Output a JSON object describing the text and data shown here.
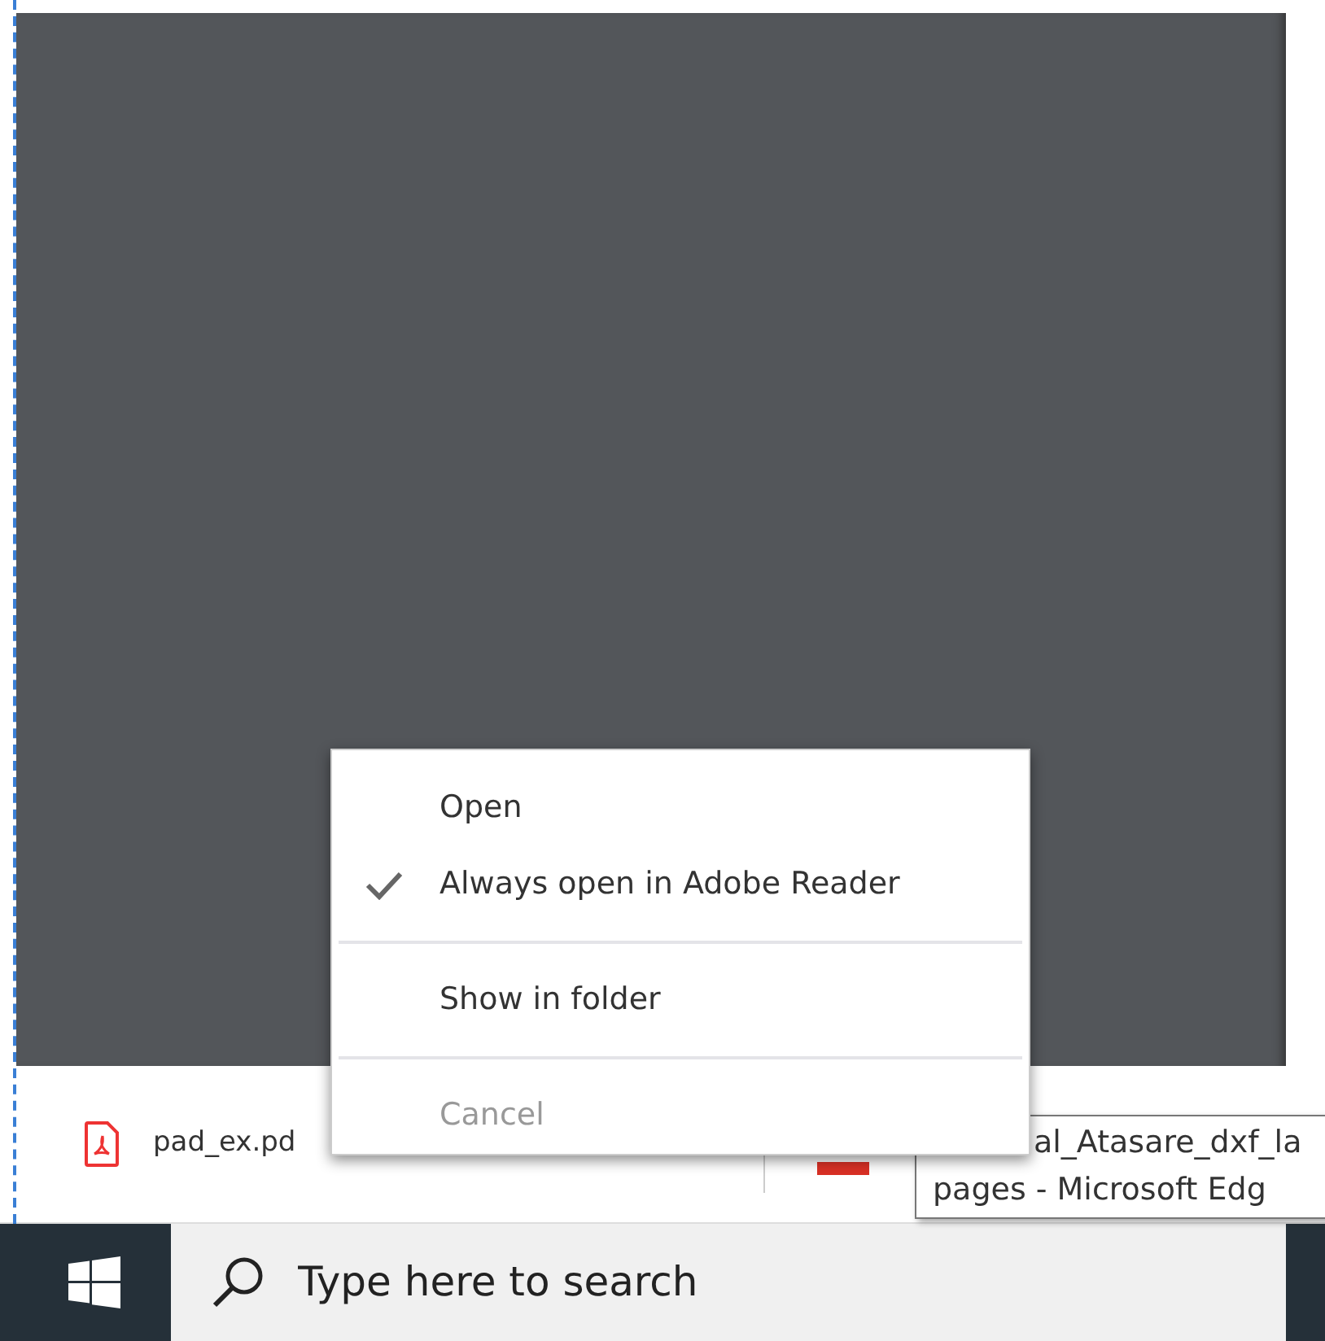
{
  "download_bar": {
    "items": [
      {
        "kind": "pdf",
        "file_name": "pad_ex.pd"
      },
      {
        "kind": "hidden"
      }
    ]
  },
  "context_menu": {
    "items": [
      {
        "kind": "item",
        "label": "Open",
        "checked": false,
        "disabled": false
      },
      {
        "kind": "item",
        "label": "Always open in Adobe Reader",
        "checked": true,
        "disabled": false
      },
      {
        "kind": "divider"
      },
      {
        "kind": "item",
        "label": "Show in folder",
        "checked": false,
        "disabled": false
      },
      {
        "kind": "divider"
      },
      {
        "kind": "item",
        "label": "Cancel",
        "checked": false,
        "disabled": true
      }
    ]
  },
  "tooltip": {
    "lines": [
      "al_Atasare_dxf_la",
      "pages - Microsoft Edg"
    ]
  },
  "taskbar": {
    "search": {
      "placeholder": "Type here to search"
    }
  }
}
